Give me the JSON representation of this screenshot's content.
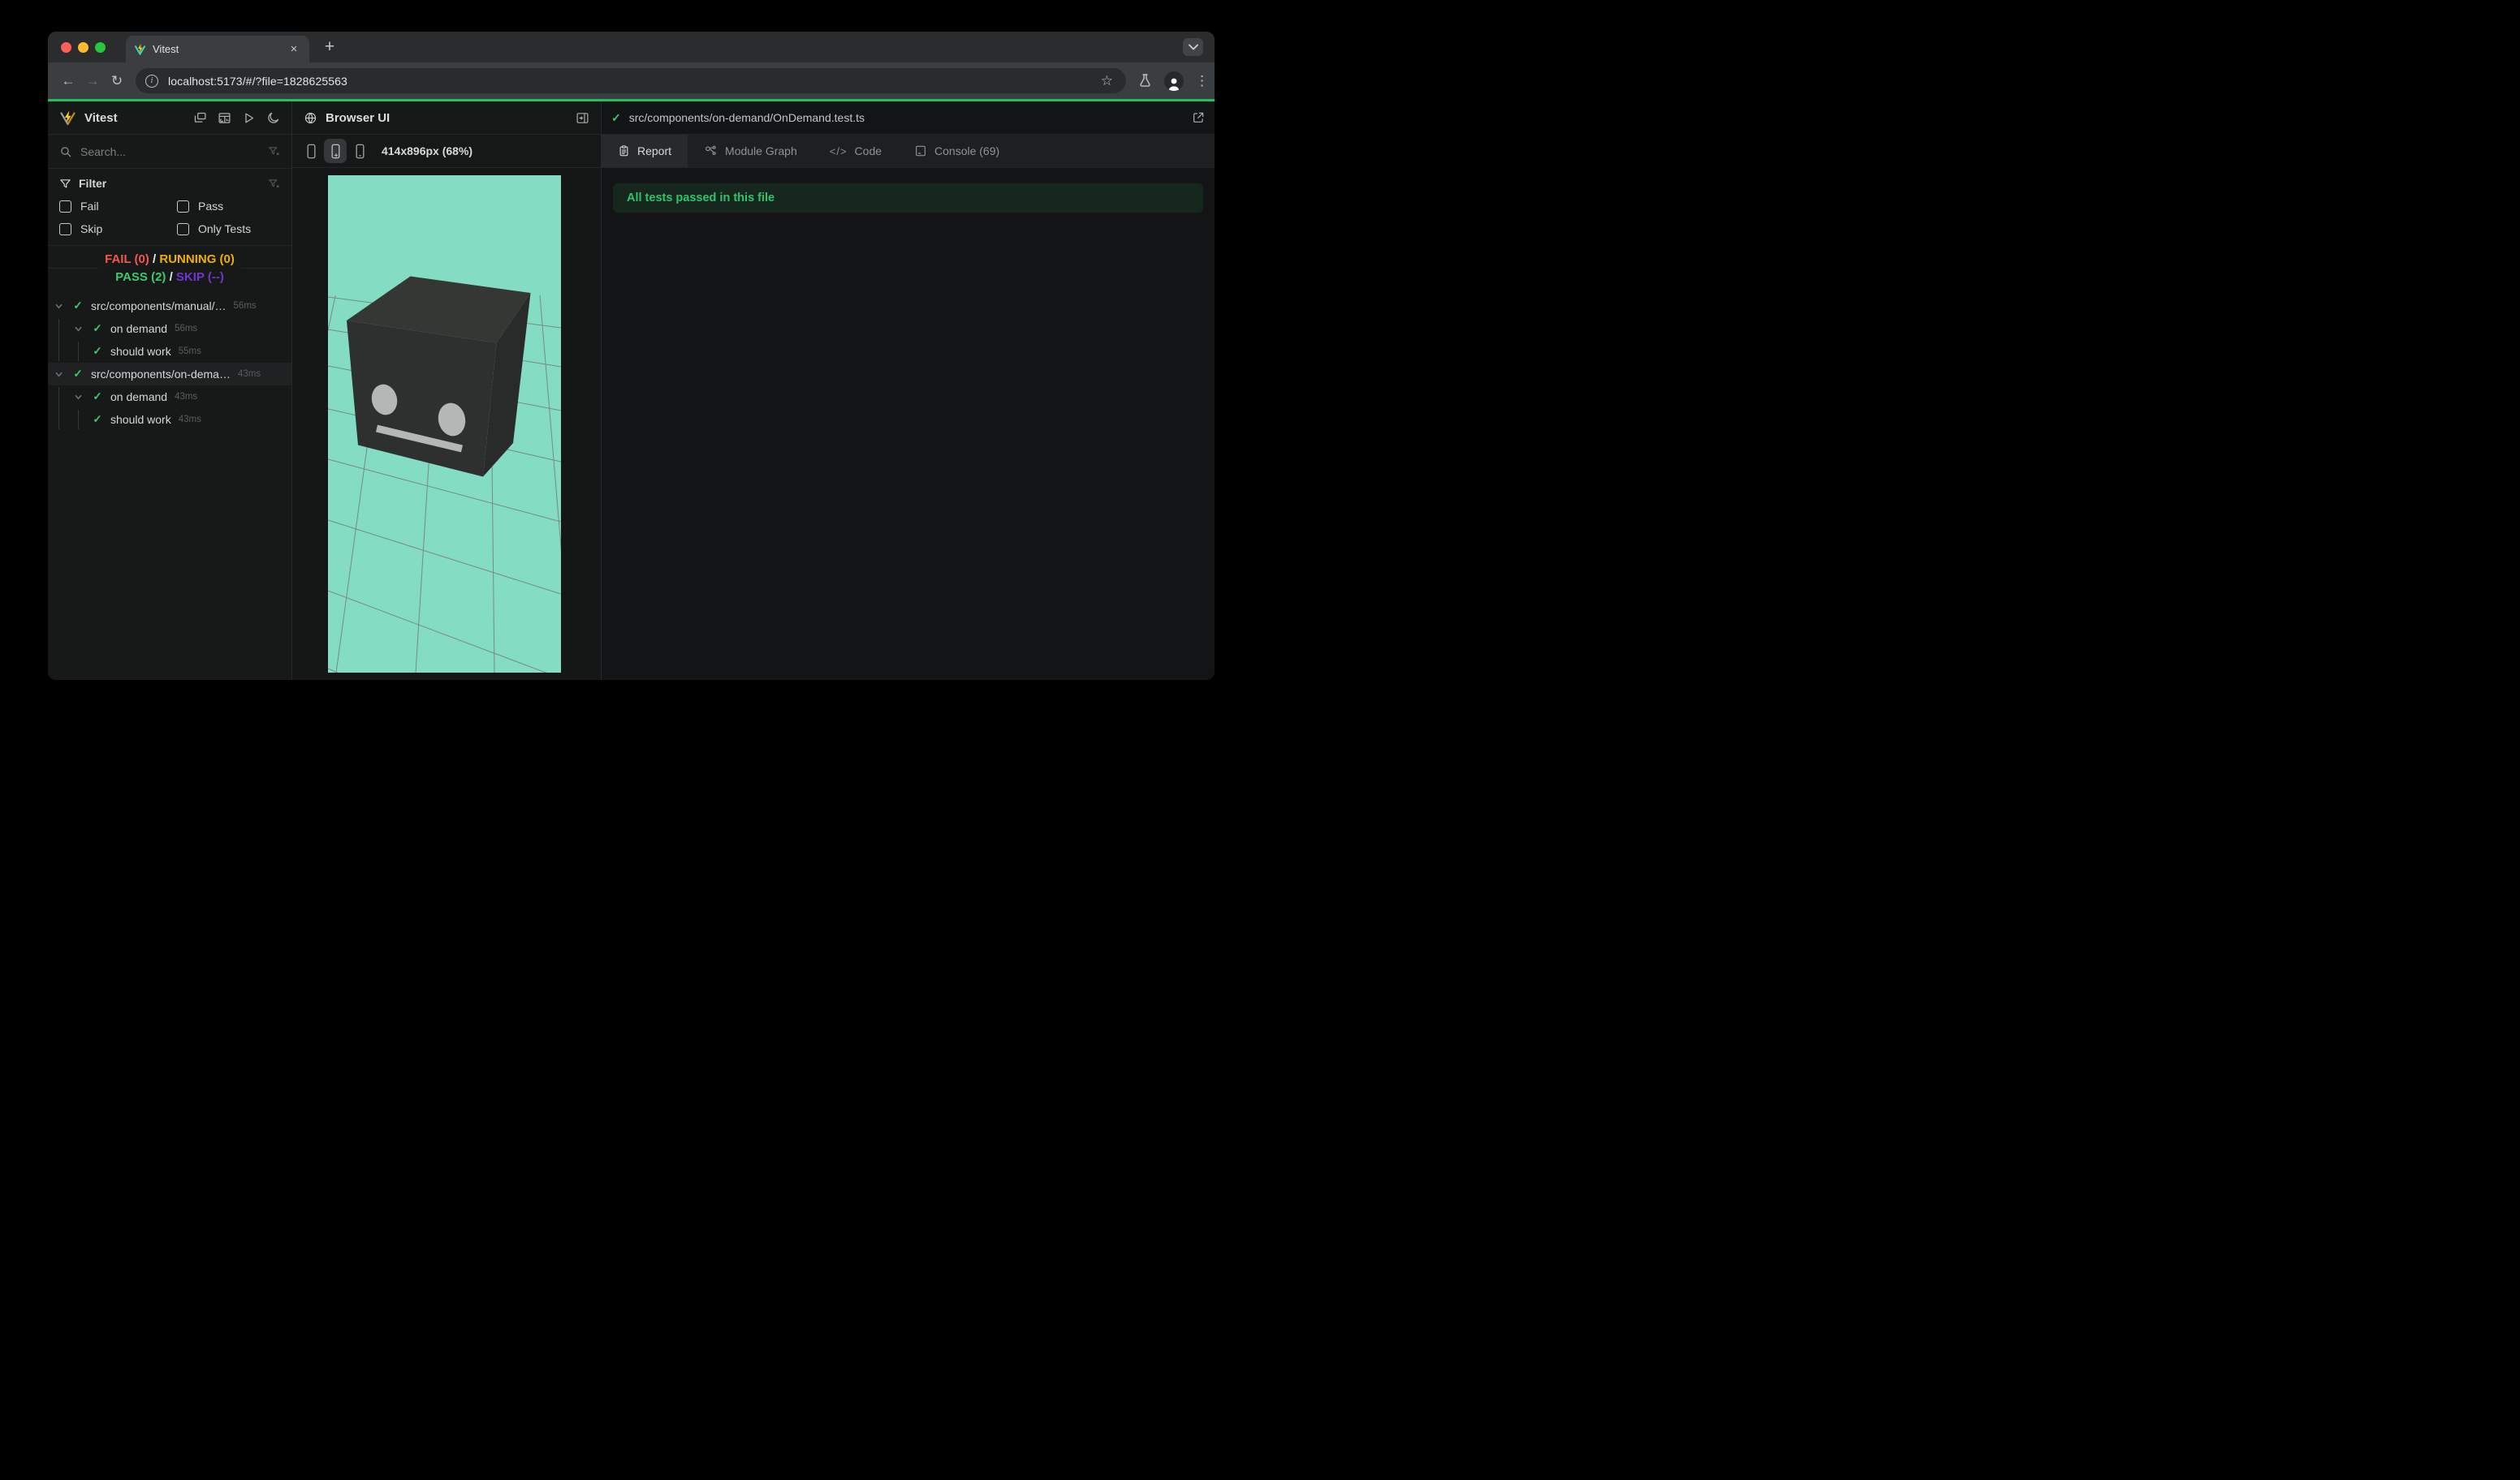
{
  "browser": {
    "tab_title": "Vitest",
    "close_glyph": "×",
    "new_tab_glyph": "+",
    "url": "localhost:5173/#/?file=1828625563"
  },
  "sidebar": {
    "title": "Vitest",
    "search_placeholder": "Search...",
    "filter": {
      "title": "Filter",
      "options": [
        {
          "label": "Fail"
        },
        {
          "label": "Pass"
        },
        {
          "label": "Skip"
        },
        {
          "label": "Only Tests"
        }
      ]
    },
    "status": {
      "fail": "FAIL (0)",
      "sep1": "/",
      "running": "RUNNING (0)",
      "pass": "PASS (2)",
      "sep2": "/",
      "skip": "SKIP (--)"
    },
    "tree": [
      {
        "label": "src/components/manual/…",
        "time": "56ms"
      },
      {
        "label": "on demand",
        "time": "56ms"
      },
      {
        "label": "should work",
        "time": "55ms"
      },
      {
        "label": "src/components/on-dema…",
        "time": "43ms"
      },
      {
        "label": "on demand",
        "time": "43ms"
      },
      {
        "label": "should work",
        "time": "43ms"
      }
    ],
    "check_glyph": "✓"
  },
  "preview_panel": {
    "title": "Browser UI",
    "viewport_label": "414x896px (68%)"
  },
  "report_panel": {
    "file_path": "src/components/on-demand/OnDemand.test.ts",
    "check_glyph": "✓",
    "tabs": [
      {
        "label": "Report"
      },
      {
        "label": "Module Graph"
      },
      {
        "label": "Code"
      },
      {
        "label": "Console (69)"
      }
    ],
    "code_tab_glyph": "</>",
    "banner": "All tests passed in this file"
  },
  "colors": {
    "progress_green": "#23c05c",
    "mint_background": "#84dcc3",
    "fail_red": "#f2564d",
    "running_yellow": "#eeb005",
    "pass_green": "#36cb70",
    "skip_purple": "#6f35cf"
  }
}
